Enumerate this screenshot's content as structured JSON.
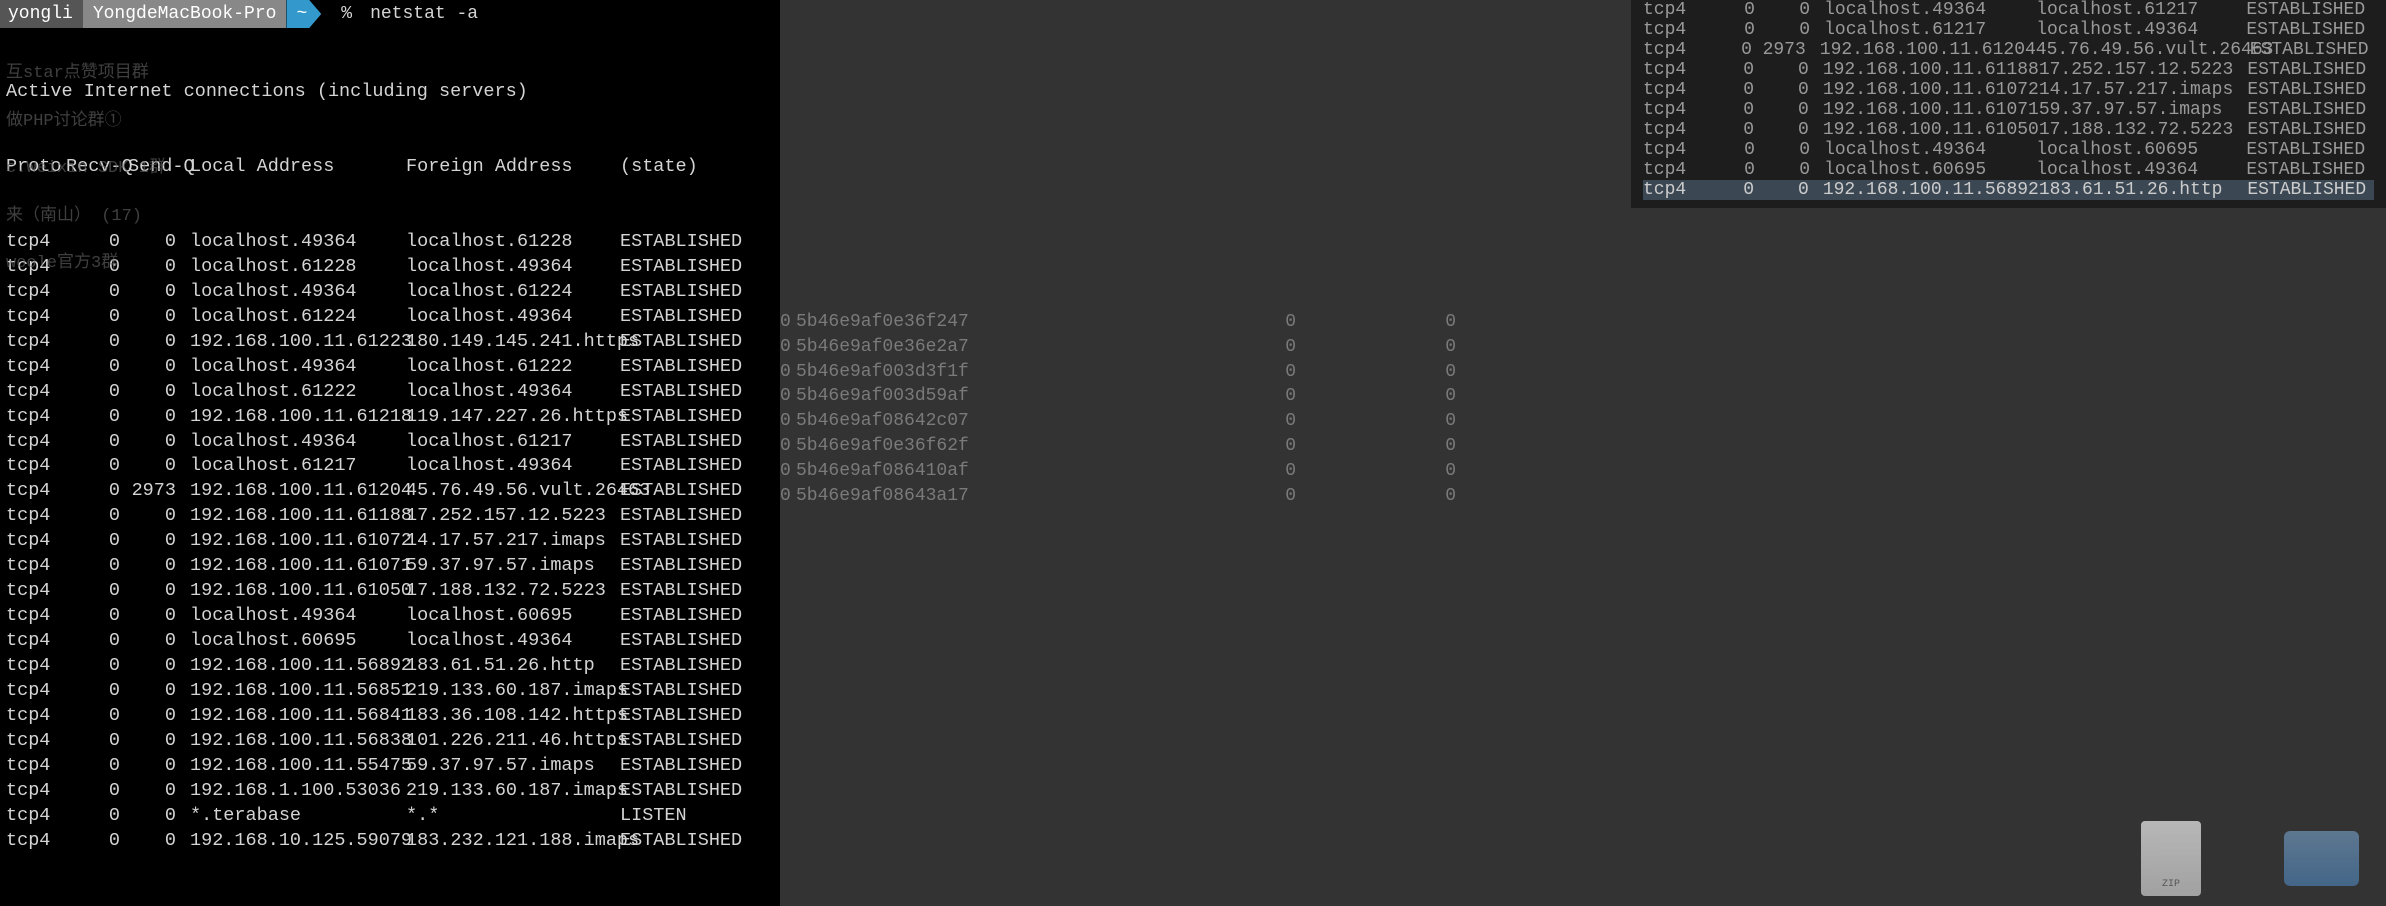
{
  "prompt": {
    "user": "yongli",
    "host": "YongdeMacBook-Pro",
    "dir": "~",
    "symbol": "%",
    "command": "netstat -a"
  },
  "header_line": "Active Internet connections (including servers)",
  "columns": {
    "proto": "Proto",
    "recvq": "Recv-Q",
    "sendq": "Send-Q",
    "local": "Local Address",
    "foreign": "Foreign Address",
    "state": "(state)"
  },
  "rows": [
    {
      "proto": "tcp4",
      "recvq": "0",
      "sendq": "0",
      "local": "localhost.49364",
      "foreign": "localhost.61228",
      "state": "ESTABLISHED"
    },
    {
      "proto": "tcp4",
      "recvq": "0",
      "sendq": "0",
      "local": "localhost.61228",
      "foreign": "localhost.49364",
      "state": "ESTABLISHED"
    },
    {
      "proto": "tcp4",
      "recvq": "0",
      "sendq": "0",
      "local": "localhost.49364",
      "foreign": "localhost.61224",
      "state": "ESTABLISHED"
    },
    {
      "proto": "tcp4",
      "recvq": "0",
      "sendq": "0",
      "local": "localhost.61224",
      "foreign": "localhost.49364",
      "state": "ESTABLISHED"
    },
    {
      "proto": "tcp4",
      "recvq": "0",
      "sendq": "0",
      "local": "192.168.100.11.61223",
      "foreign": "180.149.145.241.https",
      "state": "ESTABLISHED"
    },
    {
      "proto": "tcp4",
      "recvq": "0",
      "sendq": "0",
      "local": "localhost.49364",
      "foreign": "localhost.61222",
      "state": "ESTABLISHED"
    },
    {
      "proto": "tcp4",
      "recvq": "0",
      "sendq": "0",
      "local": "localhost.61222",
      "foreign": "localhost.49364",
      "state": "ESTABLISHED"
    },
    {
      "proto": "tcp4",
      "recvq": "0",
      "sendq": "0",
      "local": "192.168.100.11.61218",
      "foreign": "119.147.227.26.https",
      "state": "ESTABLISHED"
    },
    {
      "proto": "tcp4",
      "recvq": "0",
      "sendq": "0",
      "local": "localhost.49364",
      "foreign": "localhost.61217",
      "state": "ESTABLISHED"
    },
    {
      "proto": "tcp4",
      "recvq": "0",
      "sendq": "0",
      "local": "localhost.61217",
      "foreign": "localhost.49364",
      "state": "ESTABLISHED"
    },
    {
      "proto": "tcp4",
      "recvq": "0",
      "sendq": "2973",
      "local": "192.168.100.11.61204",
      "foreign": "45.76.49.56.vult.26463",
      "state": "ESTABLISHED"
    },
    {
      "proto": "tcp4",
      "recvq": "0",
      "sendq": "0",
      "local": "192.168.100.11.61188",
      "foreign": "17.252.157.12.5223",
      "state": "ESTABLISHED"
    },
    {
      "proto": "tcp4",
      "recvq": "0",
      "sendq": "0",
      "local": "192.168.100.11.61072",
      "foreign": "14.17.57.217.imaps",
      "state": "ESTABLISHED"
    },
    {
      "proto": "tcp4",
      "recvq": "0",
      "sendq": "0",
      "local": "192.168.100.11.61071",
      "foreign": "59.37.97.57.imaps",
      "state": "ESTABLISHED"
    },
    {
      "proto": "tcp4",
      "recvq": "0",
      "sendq": "0",
      "local": "192.168.100.11.61050",
      "foreign": "17.188.132.72.5223",
      "state": "ESTABLISHED"
    },
    {
      "proto": "tcp4",
      "recvq": "0",
      "sendq": "0",
      "local": "localhost.49364",
      "foreign": "localhost.60695",
      "state": "ESTABLISHED"
    },
    {
      "proto": "tcp4",
      "recvq": "0",
      "sendq": "0",
      "local": "localhost.60695",
      "foreign": "localhost.49364",
      "state": "ESTABLISHED"
    },
    {
      "proto": "tcp4",
      "recvq": "0",
      "sendq": "0",
      "local": "192.168.100.11.56892",
      "foreign": "183.61.51.26.http",
      "state": "ESTABLISHED"
    },
    {
      "proto": "tcp4",
      "recvq": "0",
      "sendq": "0",
      "local": "192.168.100.11.56851",
      "foreign": "219.133.60.187.imaps",
      "state": "ESTABLISHED"
    },
    {
      "proto": "tcp4",
      "recvq": "0",
      "sendq": "0",
      "local": "192.168.100.11.56841",
      "foreign": "183.36.108.142.https",
      "state": "ESTABLISHED"
    },
    {
      "proto": "tcp4",
      "recvq": "0",
      "sendq": "0",
      "local": "192.168.100.11.56838",
      "foreign": "101.226.211.46.https",
      "state": "ESTABLISHED"
    },
    {
      "proto": "tcp4",
      "recvq": "0",
      "sendq": "0",
      "local": "192.168.100.11.55475",
      "foreign": "59.37.97.57.imaps",
      "state": "ESTABLISHED"
    },
    {
      "proto": "tcp4",
      "recvq": "0",
      "sendq": "0",
      "local": "192.168.1.100.53036",
      "foreign": "219.133.60.187.imaps",
      "state": "ESTABLISHED"
    },
    {
      "proto": "tcp4",
      "recvq": "0",
      "sendq": "0",
      "local": "*.terabase",
      "foreign": "*.*",
      "state": "LISTEN"
    },
    {
      "proto": "tcp4",
      "recvq": "0",
      "sendq": "0",
      "local": "192.168.10.125.59079",
      "foreign": "183.232.121.188.imaps",
      "state": "ESTABLISHED"
    }
  ],
  "right_rows": [
    {
      "proto": "tcp4",
      "recvq": "0",
      "sendq": "0",
      "local": "localhost.49364",
      "foreign": "localhost.61217",
      "state": "ESTABLISHED"
    },
    {
      "proto": "tcp4",
      "recvq": "0",
      "sendq": "0",
      "local": "localhost.61217",
      "foreign": "localhost.49364",
      "state": "ESTABLISHED"
    },
    {
      "proto": "tcp4",
      "recvq": "0",
      "sendq": "2973",
      "local": "192.168.100.11.61204",
      "foreign": "45.76.49.56.vult.26463",
      "state": "ESTABLISHED"
    },
    {
      "proto": "tcp4",
      "recvq": "0",
      "sendq": "0",
      "local": "192.168.100.11.61188",
      "foreign": "17.252.157.12.5223",
      "state": "ESTABLISHED"
    },
    {
      "proto": "tcp4",
      "recvq": "0",
      "sendq": "0",
      "local": "192.168.100.11.61072",
      "foreign": "14.17.57.217.imaps",
      "state": "ESTABLISHED"
    },
    {
      "proto": "tcp4",
      "recvq": "0",
      "sendq": "0",
      "local": "192.168.100.11.61071",
      "foreign": "59.37.97.57.imaps",
      "state": "ESTABLISHED"
    },
    {
      "proto": "tcp4",
      "recvq": "0",
      "sendq": "0",
      "local": "192.168.100.11.61050",
      "foreign": "17.188.132.72.5223",
      "state": "ESTABLISHED"
    },
    {
      "proto": "tcp4",
      "recvq": "0",
      "sendq": "0",
      "local": "localhost.49364",
      "foreign": "localhost.60695",
      "state": "ESTABLISHED"
    },
    {
      "proto": "tcp4",
      "recvq": "0",
      "sendq": "0",
      "local": "localhost.60695",
      "foreign": "localhost.49364",
      "state": "ESTABLISHED"
    },
    {
      "proto": "tcp4",
      "recvq": "0",
      "sendq": "0",
      "local": "192.168.100.11.56892",
      "foreign": "183.61.51.26.http",
      "state": "ESTABLISHED",
      "hl": true
    }
  ],
  "hashes": [
    {
      "n": "0",
      "h": "5b46e9af0e36f247",
      "a": "0",
      "b": "0"
    },
    {
      "n": "0",
      "h": "5b46e9af0e36e2a7",
      "a": "0",
      "b": "0"
    },
    {
      "n": "0",
      "h": "5b46e9af003d3f1f",
      "a": "0",
      "b": "0"
    },
    {
      "n": "0",
      "h": "5b46e9af003d59af",
      "a": "0",
      "b": "0"
    },
    {
      "n": "0",
      "h": "5b46e9af08642c07",
      "a": "0",
      "b": "0"
    },
    {
      "n": "0",
      "h": "5b46e9af0e36f62f",
      "a": "0",
      "b": "0"
    },
    {
      "n": "0",
      "h": "5b46e9af086410af",
      "a": "0",
      "b": "0"
    },
    {
      "n": "0",
      "h": "5b46e9af08643a17",
      "a": "0",
      "b": "0"
    }
  ],
  "bg_chat": [
    "互star点赞项目群",
    "做PHP讨论群①",
    "c.Weixin SDK 1群",
    "来（南山）   (17)",
    "woole官方3群"
  ],
  "zip_label": "ZIP"
}
